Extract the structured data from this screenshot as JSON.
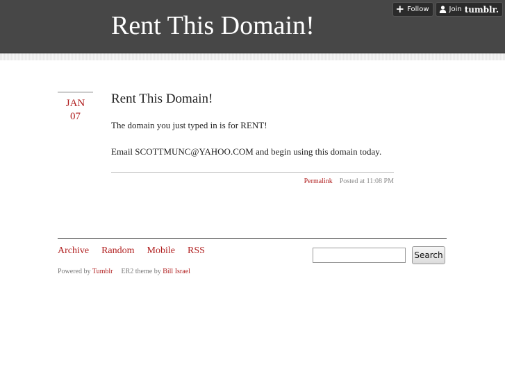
{
  "header": {
    "title": "Rent This Domain!",
    "follow_label": "Follow",
    "join_label": "Join",
    "brand": "tumblr."
  },
  "post": {
    "date_month": "JAN",
    "date_day": "07",
    "title": "Rent This Domain!",
    "paragraphs": [
      "The domain you just typed in is for RENT!",
      "Email SCOTTMUNC@YAHOO.COM and begin using this domain today."
    ],
    "permalink_label": "Permalink",
    "posted_at": "Posted at 11:08 PM"
  },
  "footer": {
    "nav": [
      "Archive",
      "Random",
      "Mobile",
      "RSS"
    ],
    "search_value": "",
    "search_button_label": "Search",
    "powered_by_prefix": "Powered by",
    "powered_by_link": "Tumblr",
    "theme_prefix": "ER2 theme by",
    "theme_author": "Bill Israel"
  },
  "colors": {
    "header_bg": "#474747",
    "accent": "#b01e1e",
    "text": "#222222"
  },
  "icons": {
    "follow": "plus-icon",
    "join": "user-icon"
  }
}
